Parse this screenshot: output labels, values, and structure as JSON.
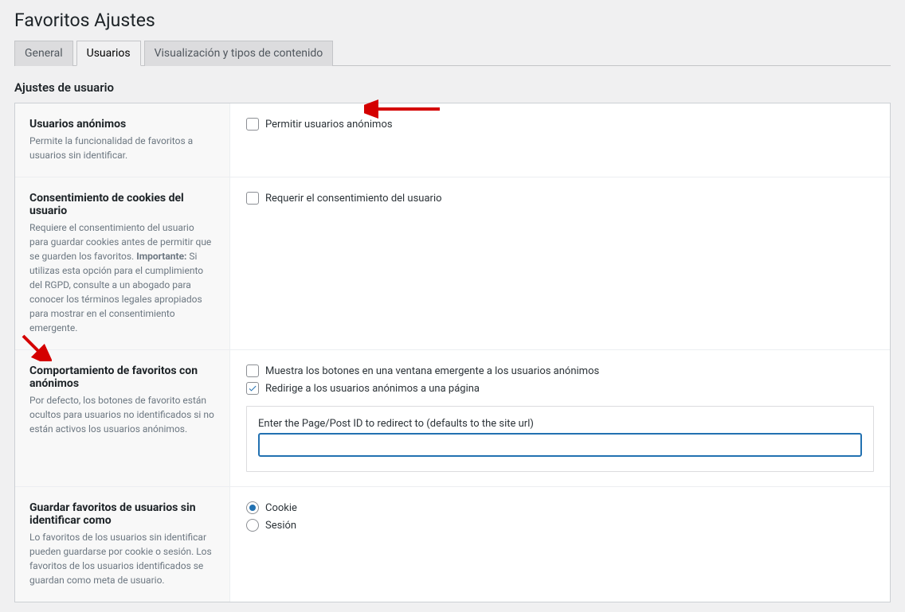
{
  "header": {
    "title": "Favoritos Ajustes"
  },
  "tabs": {
    "general": "General",
    "usuarios": "Usuarios",
    "visualizacion": "Visualización y tipos de contenido"
  },
  "section_title": "Ajustes de usuario",
  "rows": {
    "anon": {
      "title": "Usuarios anónimos",
      "desc": "Permite la funcionalidad de favoritos a usuarios sin identificar.",
      "checkbox_label": "Permitir usuarios anónimos"
    },
    "cookies": {
      "title": "Consentimiento de cookies del usuario",
      "desc_pre": "Requiere el consentimiento del usuario para guardar cookies antes de permitir que se guarden los favoritos. ",
      "desc_bold": "Importante:",
      "desc_post": " Si utilizas esta opción para el cumplimiento del RGPD, consulte a un abogado para conocer los términos legales apropiados para mostrar en el consentimiento emergente.",
      "checkbox_label": "Requerir el consentimiento del usuario"
    },
    "behavior": {
      "title": "Comportamiento de favoritos con anónimos",
      "desc": "Por defecto, los botones de favorito están ocultos para usuarios no identificados si no están activos los usuarios anónimos.",
      "opt_modal": "Muestra los botones en una ventana emergente a los usuarios anónimos",
      "opt_redirect": "Redirige a los usuarios anónimos a una página",
      "redirect_field_label": "Enter the Page/Post ID to redirect to (defaults to the site url)",
      "redirect_value": ""
    },
    "save": {
      "title": "Guardar favoritos de usuarios sin identificar como",
      "desc": "Lo favoritos de los usuarios sin identificar pueden guardarse por cookie o sesión. Los favoritos de los usuarios identificados se guardan como meta de usuario.",
      "radio_cookie": "Cookie",
      "radio_session": "Sesión"
    }
  }
}
